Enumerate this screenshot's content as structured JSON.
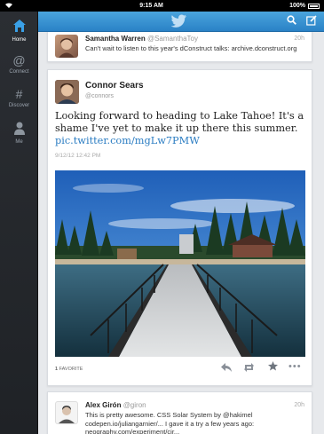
{
  "statusbar": {
    "time": "9:15 AM",
    "battery": "100%"
  },
  "sidebar": {
    "items": [
      {
        "label": "Home",
        "icon": "home-icon"
      },
      {
        "label": "Connect",
        "icon": "at-icon"
      },
      {
        "label": "Discover",
        "icon": "hashtag-icon"
      },
      {
        "label": "Me",
        "icon": "person-icon"
      }
    ]
  },
  "topbar": {
    "search_icon": "search-icon",
    "compose_icon": "compose-icon",
    "logo": "twitter-bird-logo"
  },
  "tweets": [
    {
      "name": "Samantha Warren",
      "handle": "@SamanthaToy",
      "time": "20h",
      "text": "Can't wait to listen to this year's dConstruct talks: archive.dconstruct.org"
    },
    {
      "name": "Connor Sears",
      "handle": "@connors",
      "text_before": "Looking forward to heading to Lake Tahoe! It's a shame I've yet to make it up there this summer.",
      "link": "pic.twitter.com/mgLw7PMW",
      "timestamp": "9/12/12 12:42 PM",
      "favorites": "1",
      "favorites_label": "FAVORITE"
    },
    {
      "name": "Alex Girón",
      "handle": "@giron",
      "time": "20h",
      "text": "This is pretty awesome. CSS Solar System by @hakimel codepen.io/juliangarnier/... I gave it a try a few years ago: neography.com/experiment/cir..."
    }
  ]
}
